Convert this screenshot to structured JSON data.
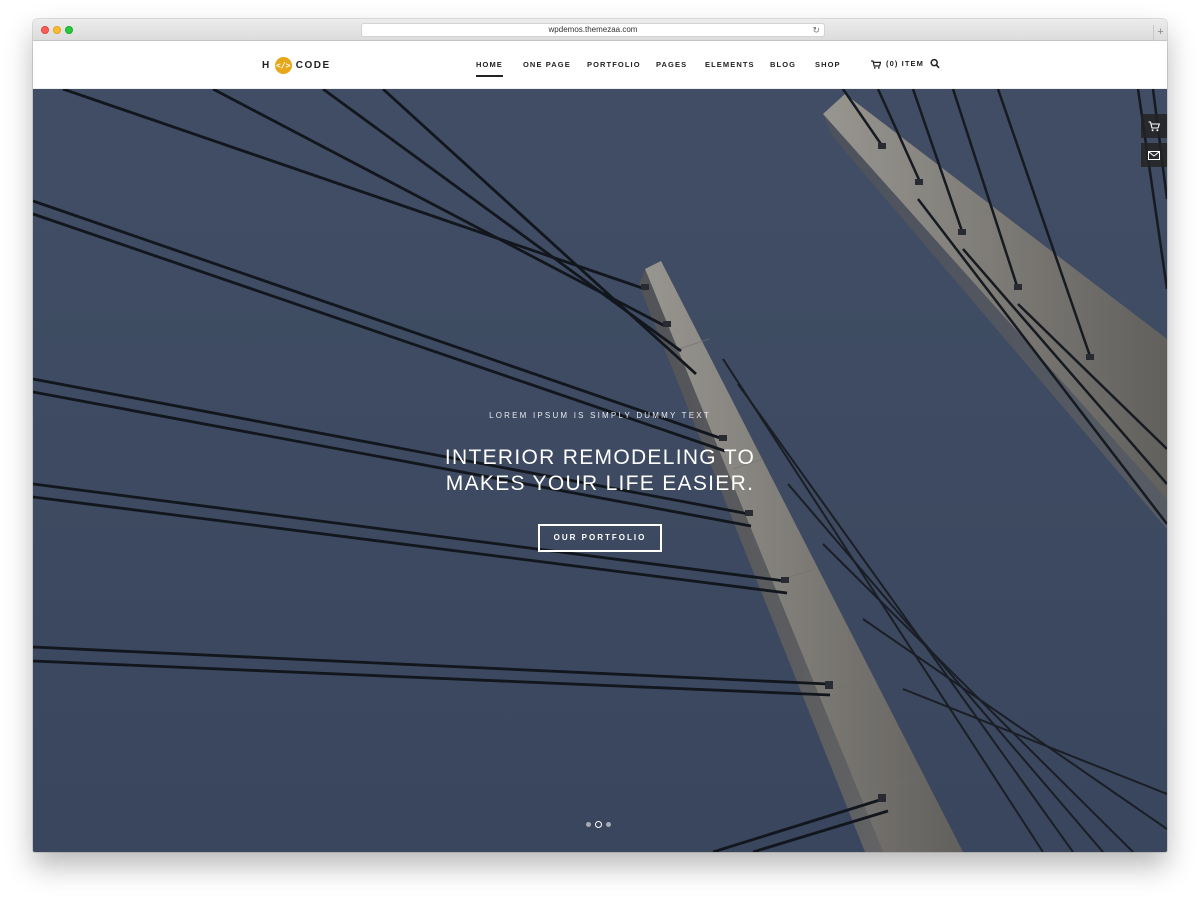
{
  "browser": {
    "url": "wpdemos.themezaa.com"
  },
  "logo": {
    "left": "H",
    "mark": "</>",
    "right": "CODE",
    "accent": "#e6a71a"
  },
  "nav": {
    "items": [
      {
        "label": "HOME",
        "active": true
      },
      {
        "label": "ONE PAGE"
      },
      {
        "label": "PORTFOLIO"
      },
      {
        "label": "PAGES"
      },
      {
        "label": "ELEMENTS"
      },
      {
        "label": "BLOG"
      },
      {
        "label": "SHOP"
      }
    ],
    "cart_label": "(0) ITEM"
  },
  "hero": {
    "kicker": "LOREM IPSUM IS SIMPLY DUMMY TEXT",
    "headline_line1": "INTERIOR REMODELING TO",
    "headline_line2": "MAKES YOUR LIFE EASIER.",
    "cta_label": "OUR PORTFOLIO",
    "background_color": "#435066",
    "slides": 3,
    "active_slide": 2
  },
  "side_tabs": [
    {
      "icon": "cart-icon"
    },
    {
      "icon": "mail-icon"
    }
  ]
}
